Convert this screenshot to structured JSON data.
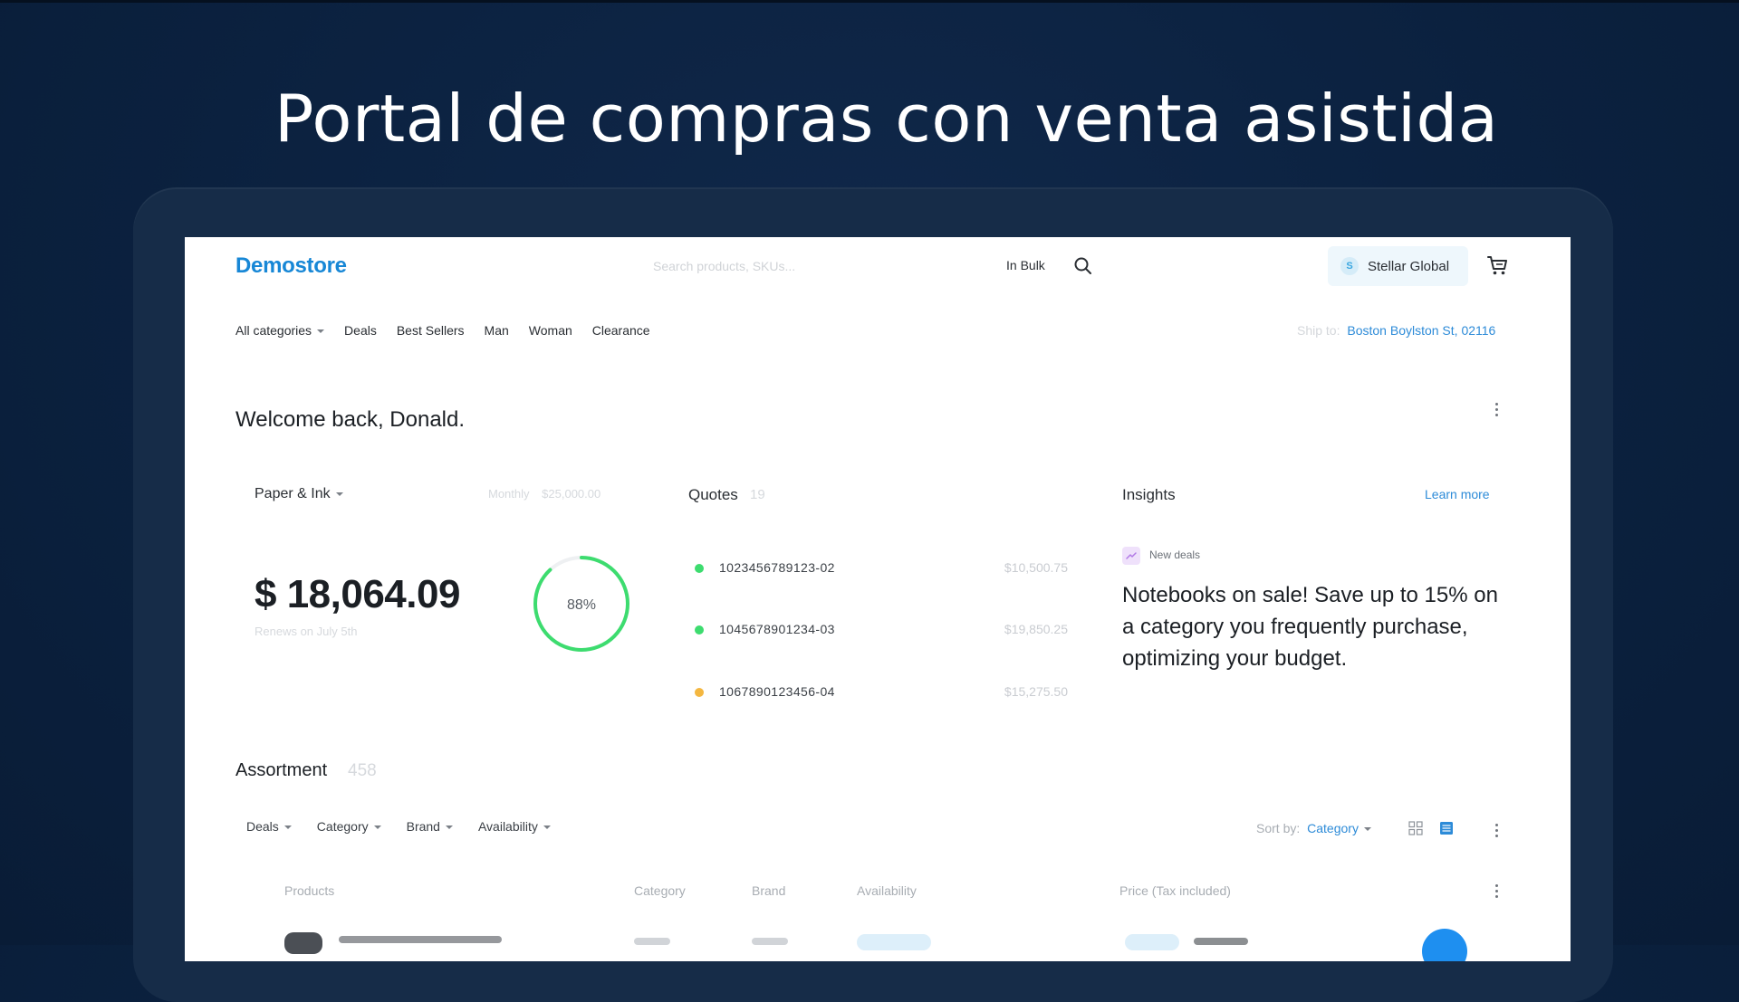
{
  "hero": {
    "title": "Portal de compras con venta asistida"
  },
  "header": {
    "logo": "Demostore",
    "search_placeholder": "Search products, SKUs...",
    "bulk_label": "In Bulk",
    "account_initial": "S",
    "account_name": "Stellar Global"
  },
  "nav": {
    "items": [
      "All categories",
      "Deals",
      "Best Sellers",
      "Man",
      "Woman",
      "Clearance"
    ],
    "ship_label": "Ship to:",
    "ship_value": "Boston Boylston St, 02116"
  },
  "welcome": {
    "title": "Welcome back, Donald."
  },
  "budget": {
    "category": "Paper & Ink",
    "period": "Monthly",
    "limit": "$25,000.00",
    "amount": "$ 18,064.09",
    "renews": "Renews on July 5th",
    "percent_label": "88%",
    "percent": 0.88,
    "ring_color": "#3ddc6f"
  },
  "quotes": {
    "title": "Quotes",
    "count": "19",
    "items": [
      {
        "id": "1023456789123-02",
        "amount": "$10,500.75",
        "color": "#3ddc6f"
      },
      {
        "id": "1045678901234-03",
        "amount": "$19,850.25",
        "color": "#3ddc6f"
      },
      {
        "id": "1067890123456-04",
        "amount": "$15,275.50",
        "color": "#f4b740"
      }
    ]
  },
  "insights": {
    "title": "Insights",
    "learn_more": "Learn more",
    "tag": "New deals",
    "text": "Notebooks on sale! Save up to 15% on a category you frequently purchase, optimizing your budget."
  },
  "assortment": {
    "title": "Assortment",
    "count": "458",
    "filters": [
      "Deals",
      "Category",
      "Brand",
      "Availability"
    ],
    "sort_label": "Sort by:",
    "sort_value": "Category",
    "columns": {
      "products": "Products",
      "category": "Category",
      "brand": "Brand",
      "availability": "Availability",
      "price": "Price (Tax included)"
    }
  },
  "colors": {
    "brand": "#1787d6",
    "accent": "#2d8bd8",
    "success": "#3ddc6f",
    "warning": "#f4b740"
  }
}
